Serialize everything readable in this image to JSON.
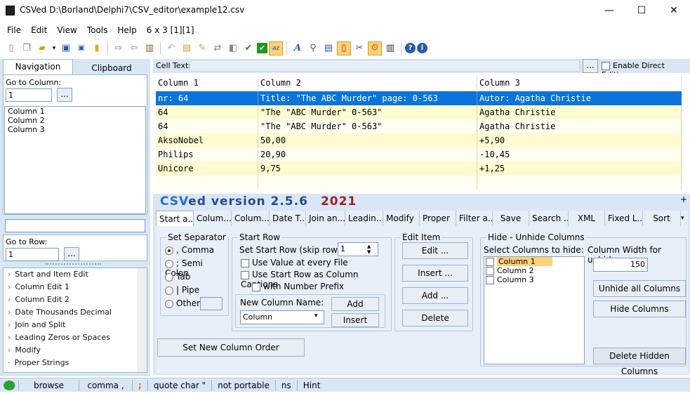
{
  "window": {
    "title": "CSVed D:\\Borland\\Delphi7\\CSV_editor\\example12.csv",
    "minimize": "—",
    "maximize": "☐",
    "close": "✕"
  },
  "menu": {
    "items": [
      "File",
      "Edit",
      "View",
      "Tools",
      "Help"
    ],
    "dimensions": "6 x 3 [1][1]"
  },
  "toolbar": {
    "icons": [
      "new-file-icon",
      "copy-file-icon",
      "open-folder-icon",
      "dropdown-icon",
      "save-icon",
      "save-small-icon",
      "folder-icon",
      "export-icon",
      "import-icon",
      "book-icon",
      "undo-icon",
      "paste-icon",
      "edit-icon",
      "replace-icon",
      "settings-icon",
      "check-green-icon",
      "checkbox-icon",
      "sort-icon",
      "italic-a-icon",
      "search-icon",
      "columns-icon",
      "page-icon",
      "tools-icon",
      "gear-icon",
      "grid-icon",
      "help-icon",
      "info-icon"
    ]
  },
  "left": {
    "tabs": [
      "Navigation",
      "Clipboard"
    ],
    "go_to_column_label": "Go to Column:",
    "go_to_column_value": "1",
    "go_button": "...",
    "columns": [
      "Column 1",
      "Column 2",
      "Column 3"
    ],
    "go_to_row_label": "Go to Row:",
    "go_to_row_value": "1",
    "tree": [
      "Start and Item Edit",
      "Column Edit 1",
      "Column Edit 2",
      "Date Thousands Decimal",
      "Join and Split",
      "Leading Zeros or Spaces",
      "Modify",
      "Proper Strings"
    ]
  },
  "celltext": {
    "label": "Cell Text:",
    "button": "...",
    "enable_direct_editing": "Enable Direct Editing"
  },
  "grid": {
    "headers": [
      "Column 1",
      "Column 2",
      "Column 3"
    ],
    "rows": [
      [
        "nr: 64",
        "Title: \"The ABC Murder\" page: 0-563",
        "Autor: Agatha Christie"
      ],
      [
        "64",
        "\"The \"ABC Murder\" 0-563\"",
        "Agatha Christie"
      ],
      [
        "64",
        "\"The \"ABC Murder\" 0-563\"",
        "Agatha Christie"
      ],
      [
        "AksoNobel",
        "50,00",
        "+5,90"
      ],
      [
        "Philips",
        "20,90",
        "-10,45"
      ],
      [
        "Unicore",
        "9,75",
        "+1,25"
      ]
    ],
    "selected_row_color": "#0a74da",
    "alt_row_color": "#fffbd0"
  },
  "brand": {
    "name_prefix": "CSV",
    "name_suffix": "ed version 2.5.6",
    "year": "2021",
    "plus": "+"
  },
  "tabs": [
    "Start a...",
    "Colum...",
    "Colum...",
    "Date T...",
    "Join an...",
    "Leadin...",
    "Modify",
    "Proper",
    "Filter a...",
    "Save",
    "Search ...",
    "XML",
    "Fixed L...",
    "Sort"
  ],
  "separator": {
    "title": "Set Separator",
    "options": [
      ", Comma",
      "; Semi Colon",
      "Tab",
      "| Pipe",
      "Other"
    ]
  },
  "start_row": {
    "title": "Start Row",
    "set_label": "Set Start Row (skip rows):",
    "value": "1",
    "use_value": "Use Value at every File",
    "use_start_row": "Use Start Row as Column Captions",
    "with_number": "with Number Prefix",
    "new_column_name_label": "New Column Name:",
    "new_column_value": "Column",
    "add": "Add",
    "insert": "Insert"
  },
  "edit_item": {
    "title": "Edit Item",
    "edit": "Edit ...",
    "insert": "Insert ...",
    "add": "Add ...",
    "delete": "Delete"
  },
  "set_new_column_order": "Set New Column Order",
  "hide_unhide": {
    "title": "Hide - Unhide Columns",
    "select_label": "Select Columns to hide:",
    "columns": [
      "Column 1",
      "Column 2",
      "Column 3"
    ],
    "width_label": "Column Width for unhide:",
    "width_value": "150",
    "unhide_all": "Unhide all Columns",
    "hide": "Hide Columns",
    "delete_hidden": "Delete Hidden Columns"
  },
  "status": {
    "items": [
      "browse",
      "comma ,",
      ";",
      "quote char \"",
      "not portable",
      "ns",
      "Hint"
    ]
  }
}
